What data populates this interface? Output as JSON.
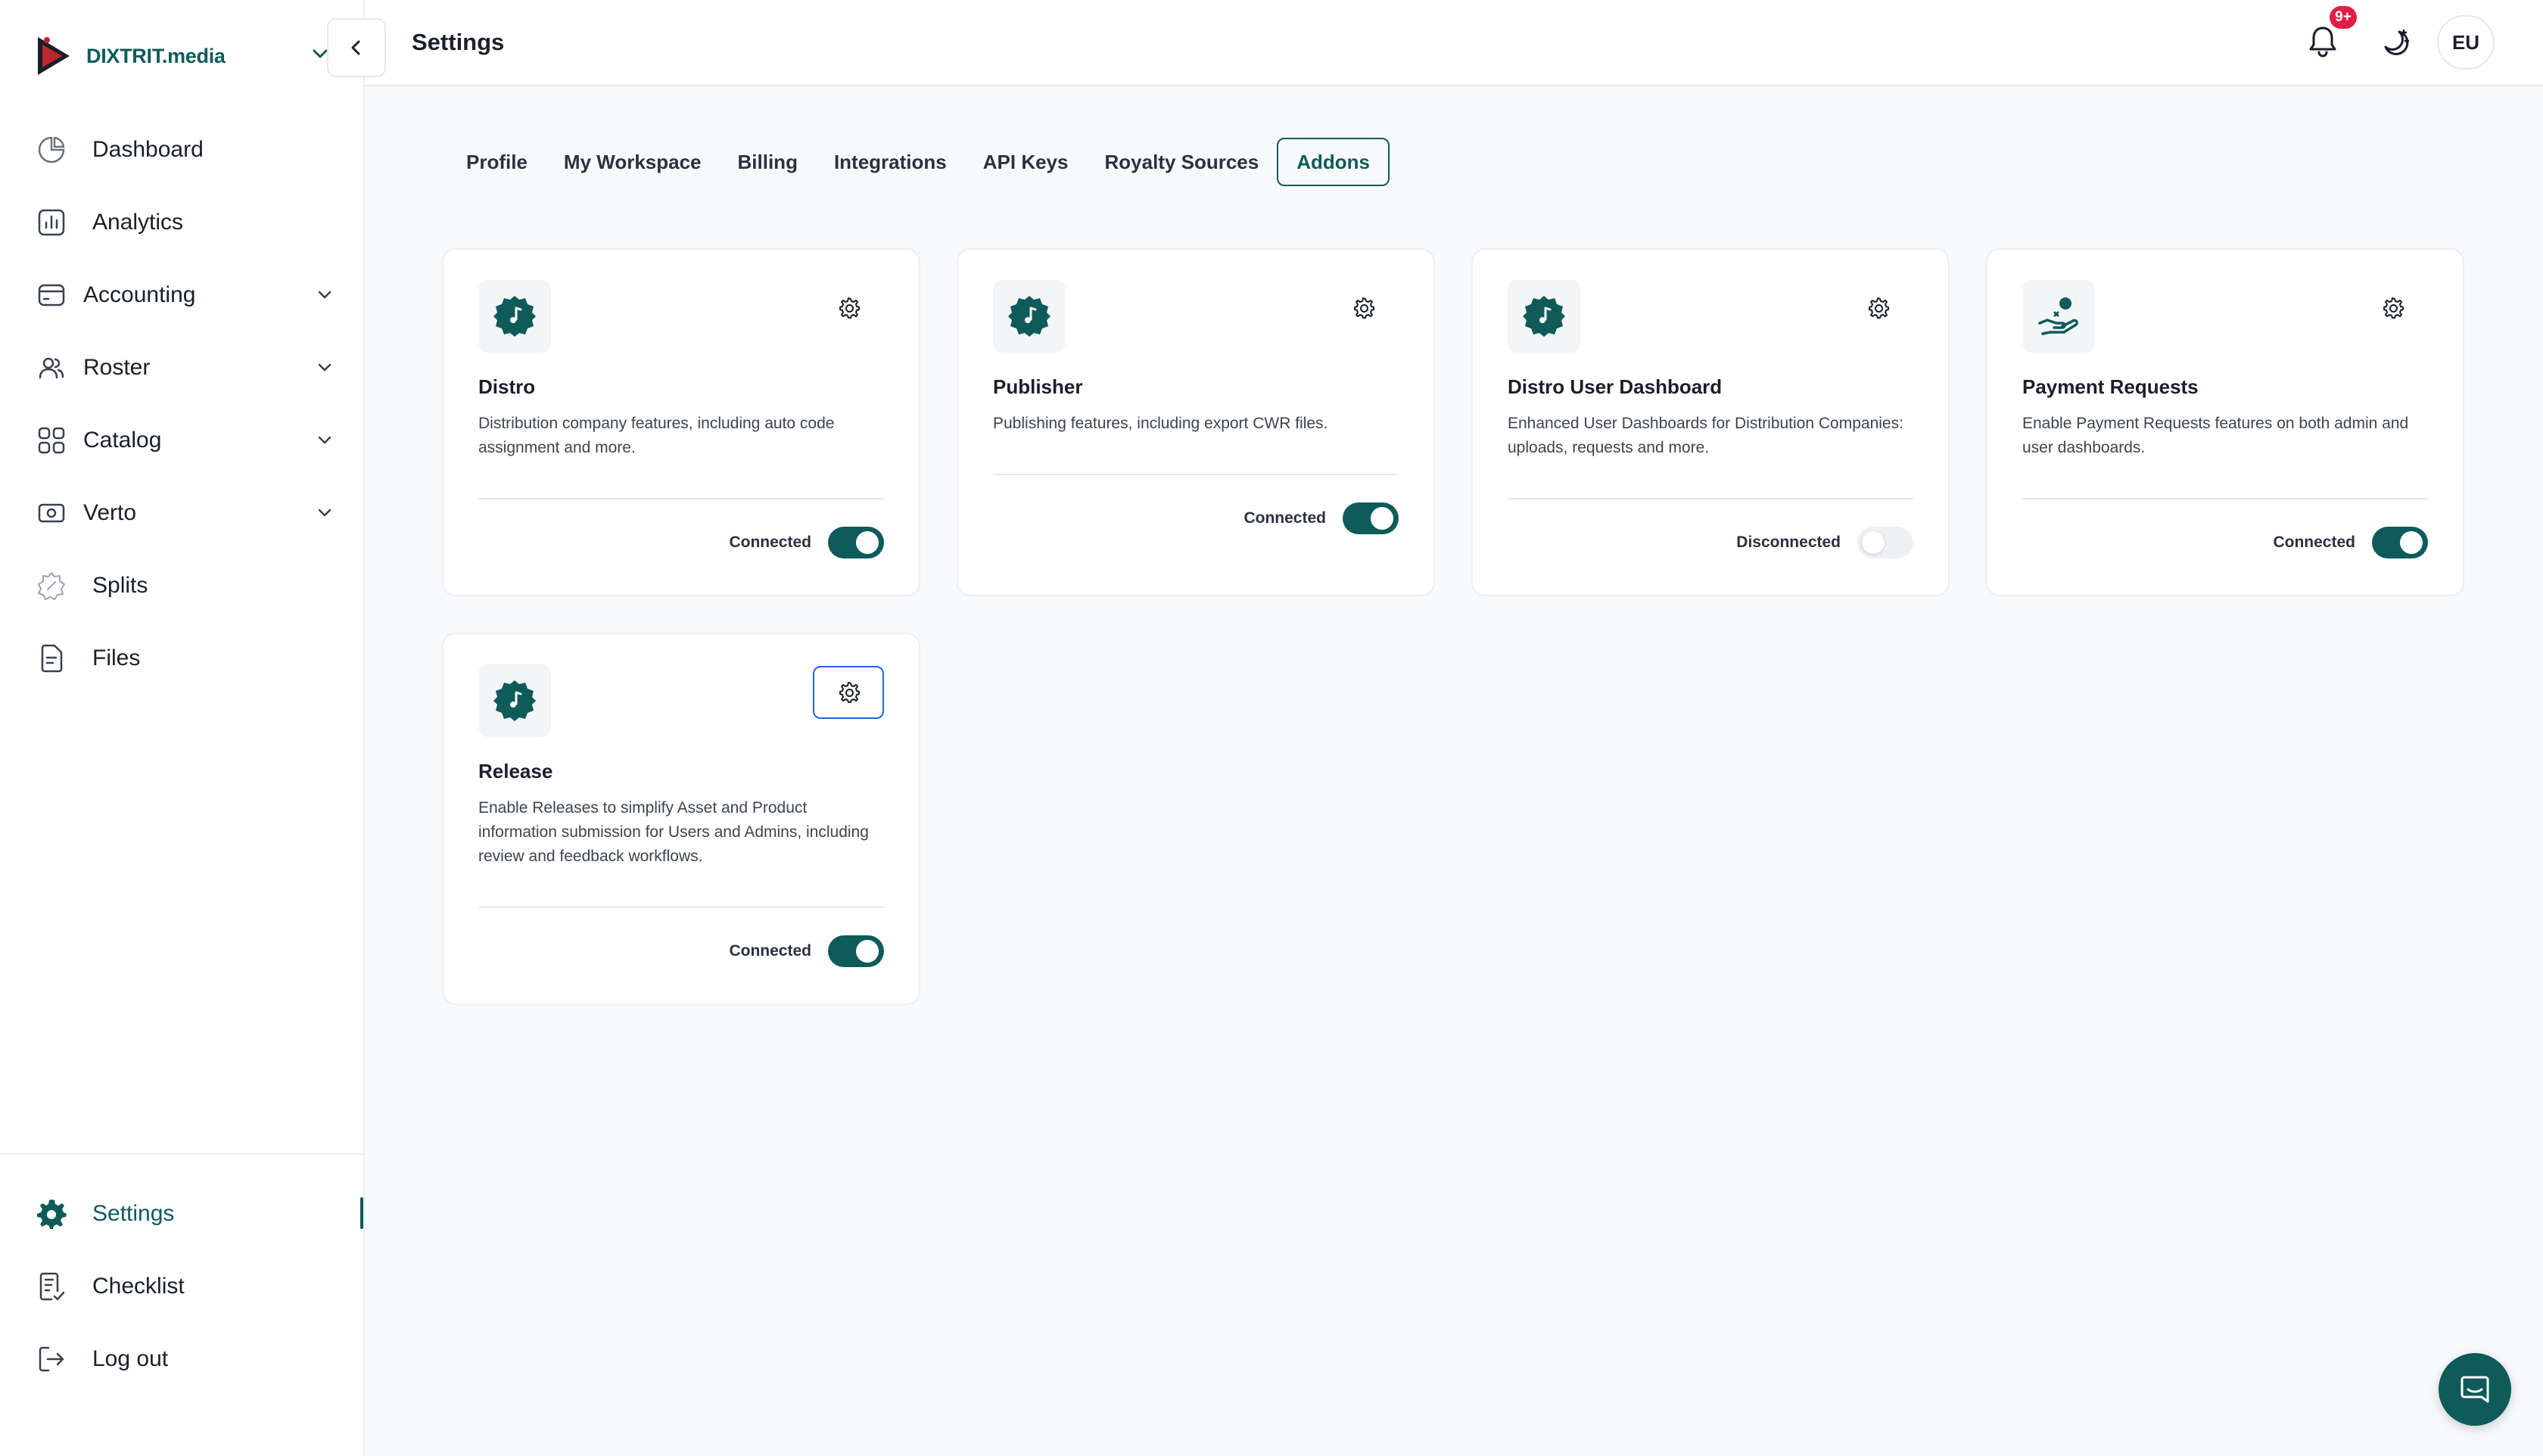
{
  "brand": {
    "name": "DIXTRIT.media"
  },
  "header": {
    "title": "Settings",
    "notifications_badge": "9+",
    "avatar_initials": "EU"
  },
  "sidebar": {
    "items": [
      {
        "label": "Dashboard",
        "icon": "pie-chart-icon",
        "expandable": false
      },
      {
        "label": "Analytics",
        "icon": "bar-chart-icon",
        "expandable": false
      },
      {
        "label": "Accounting",
        "icon": "wallet-icon",
        "expandable": true
      },
      {
        "label": "Roster",
        "icon": "users-icon",
        "expandable": true
      },
      {
        "label": "Catalog",
        "icon": "grid-icon",
        "expandable": true
      },
      {
        "label": "Verto",
        "icon": "record-icon",
        "expandable": true
      },
      {
        "label": "Splits",
        "icon": "split-icon",
        "expandable": false
      },
      {
        "label": "Files",
        "icon": "file-icon",
        "expandable": false
      }
    ],
    "bottom_items": [
      {
        "label": "Settings",
        "icon": "gear-icon",
        "active": true
      },
      {
        "label": "Checklist",
        "icon": "checklist-icon",
        "active": false
      },
      {
        "label": "Log out",
        "icon": "logout-icon",
        "active": false
      }
    ]
  },
  "tabs": [
    {
      "label": "Profile",
      "active": false
    },
    {
      "label": "My Workspace",
      "active": false
    },
    {
      "label": "Billing",
      "active": false
    },
    {
      "label": "Integrations",
      "active": false
    },
    {
      "label": "API Keys",
      "active": false
    },
    {
      "label": "Royalty Sources",
      "active": false
    },
    {
      "label": "Addons",
      "active": true
    }
  ],
  "addons": [
    {
      "title": "Distro",
      "description": "Distribution company features, including auto code assignment and more.",
      "status": "Connected",
      "enabled": true,
      "icon": "music-badge-icon"
    },
    {
      "title": "Publisher",
      "description": "Publishing features, including export CWR files.",
      "status": "Connected",
      "enabled": true,
      "icon": "music-badge-icon"
    },
    {
      "title": "Distro User Dashboard",
      "description": "Enhanced User Dashboards for Distribution Companies: uploads, requests and more.",
      "status": "Disconnected",
      "enabled": false,
      "icon": "music-badge-icon"
    },
    {
      "title": "Payment Requests",
      "description": "Enable Payment Requests features on both admin and user dashboards.",
      "status": "Connected",
      "enabled": true,
      "icon": "hand-coin-icon"
    },
    {
      "title": "Release",
      "description": "Enable Releases to simplify Asset and Product information submission for Users and Admins, including review and feedback workflows.",
      "status": "Connected",
      "enabled": true,
      "icon": "music-badge-icon"
    }
  ],
  "colors": {
    "accent": "#0e5b5a",
    "badge": "#e11d48",
    "focus": "#2563eb"
  }
}
